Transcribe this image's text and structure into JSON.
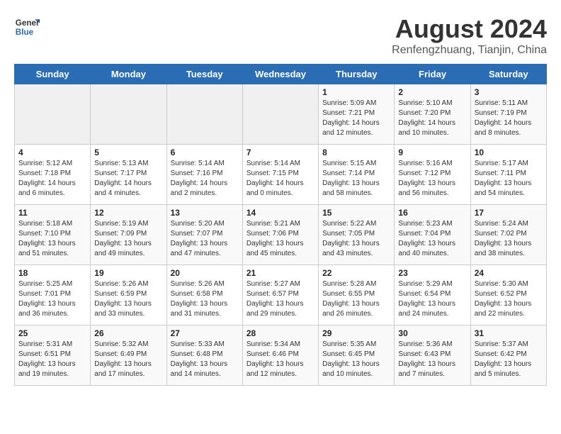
{
  "logo": {
    "general": "General",
    "blue": "Blue"
  },
  "title": "August 2024",
  "subtitle": "Renfengzhuang, Tianjin, China",
  "days_header": [
    "Sunday",
    "Monday",
    "Tuesday",
    "Wednesday",
    "Thursday",
    "Friday",
    "Saturday"
  ],
  "weeks": [
    [
      {
        "day": "",
        "empty": true
      },
      {
        "day": "",
        "empty": true
      },
      {
        "day": "",
        "empty": true
      },
      {
        "day": "",
        "empty": true
      },
      {
        "day": "1",
        "sunrise": "5:09 AM",
        "sunset": "7:21 PM",
        "daylight": "14 hours and 12 minutes."
      },
      {
        "day": "2",
        "sunrise": "5:10 AM",
        "sunset": "7:20 PM",
        "daylight": "14 hours and 10 minutes."
      },
      {
        "day": "3",
        "sunrise": "5:11 AM",
        "sunset": "7:19 PM",
        "daylight": "14 hours and 8 minutes."
      }
    ],
    [
      {
        "day": "4",
        "sunrise": "5:12 AM",
        "sunset": "7:18 PM",
        "daylight": "14 hours and 6 minutes."
      },
      {
        "day": "5",
        "sunrise": "5:13 AM",
        "sunset": "7:17 PM",
        "daylight": "14 hours and 4 minutes."
      },
      {
        "day": "6",
        "sunrise": "5:14 AM",
        "sunset": "7:16 PM",
        "daylight": "14 hours and 2 minutes."
      },
      {
        "day": "7",
        "sunrise": "5:14 AM",
        "sunset": "7:15 PM",
        "daylight": "14 hours and 0 minutes."
      },
      {
        "day": "8",
        "sunrise": "5:15 AM",
        "sunset": "7:14 PM",
        "daylight": "13 hours and 58 minutes."
      },
      {
        "day": "9",
        "sunrise": "5:16 AM",
        "sunset": "7:12 PM",
        "daylight": "13 hours and 56 minutes."
      },
      {
        "day": "10",
        "sunrise": "5:17 AM",
        "sunset": "7:11 PM",
        "daylight": "13 hours and 54 minutes."
      }
    ],
    [
      {
        "day": "11",
        "sunrise": "5:18 AM",
        "sunset": "7:10 PM",
        "daylight": "13 hours and 51 minutes."
      },
      {
        "day": "12",
        "sunrise": "5:19 AM",
        "sunset": "7:09 PM",
        "daylight": "13 hours and 49 minutes."
      },
      {
        "day": "13",
        "sunrise": "5:20 AM",
        "sunset": "7:07 PM",
        "daylight": "13 hours and 47 minutes."
      },
      {
        "day": "14",
        "sunrise": "5:21 AM",
        "sunset": "7:06 PM",
        "daylight": "13 hours and 45 minutes."
      },
      {
        "day": "15",
        "sunrise": "5:22 AM",
        "sunset": "7:05 PM",
        "daylight": "13 hours and 43 minutes."
      },
      {
        "day": "16",
        "sunrise": "5:23 AM",
        "sunset": "7:04 PM",
        "daylight": "13 hours and 40 minutes."
      },
      {
        "day": "17",
        "sunrise": "5:24 AM",
        "sunset": "7:02 PM",
        "daylight": "13 hours and 38 minutes."
      }
    ],
    [
      {
        "day": "18",
        "sunrise": "5:25 AM",
        "sunset": "7:01 PM",
        "daylight": "13 hours and 36 minutes."
      },
      {
        "day": "19",
        "sunrise": "5:26 AM",
        "sunset": "6:59 PM",
        "daylight": "13 hours and 33 minutes."
      },
      {
        "day": "20",
        "sunrise": "5:26 AM",
        "sunset": "6:58 PM",
        "daylight": "13 hours and 31 minutes."
      },
      {
        "day": "21",
        "sunrise": "5:27 AM",
        "sunset": "6:57 PM",
        "daylight": "13 hours and 29 minutes."
      },
      {
        "day": "22",
        "sunrise": "5:28 AM",
        "sunset": "6:55 PM",
        "daylight": "13 hours and 26 minutes."
      },
      {
        "day": "23",
        "sunrise": "5:29 AM",
        "sunset": "6:54 PM",
        "daylight": "13 hours and 24 minutes."
      },
      {
        "day": "24",
        "sunrise": "5:30 AM",
        "sunset": "6:52 PM",
        "daylight": "13 hours and 22 minutes."
      }
    ],
    [
      {
        "day": "25",
        "sunrise": "5:31 AM",
        "sunset": "6:51 PM",
        "daylight": "13 hours and 19 minutes."
      },
      {
        "day": "26",
        "sunrise": "5:32 AM",
        "sunset": "6:49 PM",
        "daylight": "13 hours and 17 minutes."
      },
      {
        "day": "27",
        "sunrise": "5:33 AM",
        "sunset": "6:48 PM",
        "daylight": "13 hours and 14 minutes."
      },
      {
        "day": "28",
        "sunrise": "5:34 AM",
        "sunset": "6:46 PM",
        "daylight": "13 hours and 12 minutes."
      },
      {
        "day": "29",
        "sunrise": "5:35 AM",
        "sunset": "6:45 PM",
        "daylight": "13 hours and 10 minutes."
      },
      {
        "day": "30",
        "sunrise": "5:36 AM",
        "sunset": "6:43 PM",
        "daylight": "13 hours and 7 minutes."
      },
      {
        "day": "31",
        "sunrise": "5:37 AM",
        "sunset": "6:42 PM",
        "daylight": "13 hours and 5 minutes."
      }
    ]
  ]
}
